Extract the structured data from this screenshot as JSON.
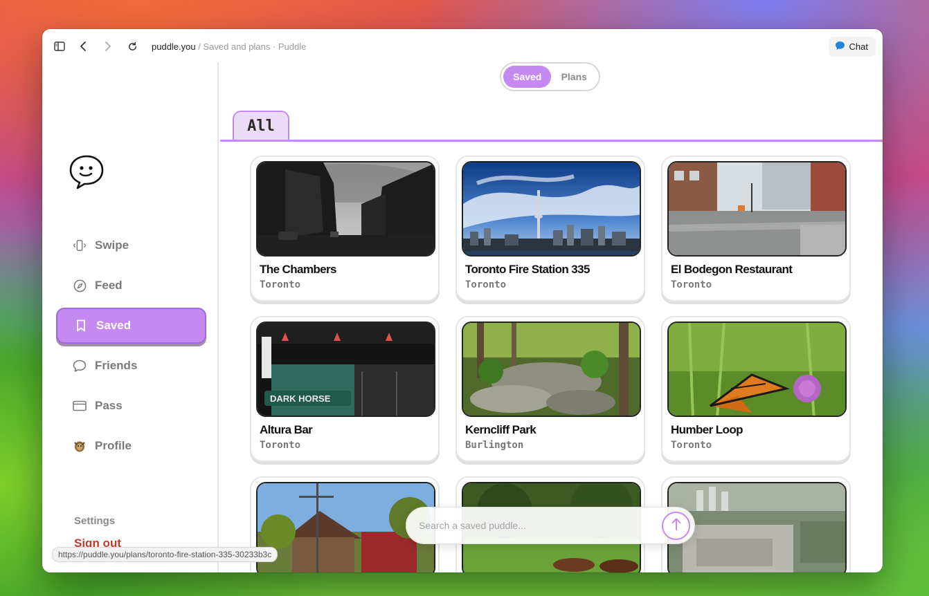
{
  "browser": {
    "url_domain": "puddle.you",
    "url_path": " / Saved and plans · Puddle",
    "chat_label": "Chat",
    "status_url": "https://puddle.you/plans/toronto-fire-station-335-30233b3c"
  },
  "sidebar": {
    "items": [
      {
        "label": "Swipe",
        "icon": "swipe-icon"
      },
      {
        "label": "Feed",
        "icon": "compass-icon"
      },
      {
        "label": "Saved",
        "icon": "bookmark-icon",
        "active": true
      },
      {
        "label": "Friends",
        "icon": "chat-bubble-icon"
      },
      {
        "label": "Pass",
        "icon": "card-icon"
      },
      {
        "label": "Profile",
        "icon": "avatar-icon"
      }
    ],
    "settings": "Settings",
    "sign_out": "Sign out"
  },
  "main": {
    "segment": {
      "saved": "Saved",
      "plans": "Plans",
      "selected": "Saved"
    },
    "tab": "All",
    "cards": [
      {
        "name": "The Chambers",
        "city": "Toronto",
        "scene": "dark-street"
      },
      {
        "name": "Toronto Fire Station 335",
        "city": "Toronto",
        "scene": "skyline"
      },
      {
        "name": "El Bodegon Restaurant",
        "city": "Toronto",
        "scene": "intersection"
      },
      {
        "name": "Altura Bar",
        "city": "Toronto",
        "scene": "bar-front"
      },
      {
        "name": "Kerncliff Park",
        "city": "Burlington",
        "scene": "forest"
      },
      {
        "name": "Humber Loop",
        "city": "Toronto",
        "scene": "butterfly"
      },
      {
        "name": "",
        "city": "",
        "scene": "houses"
      },
      {
        "name": "",
        "city": "",
        "scene": "park-cows"
      },
      {
        "name": "",
        "city": "",
        "scene": "aerial"
      }
    ],
    "search": {
      "placeholder": "Search a saved puddle..."
    }
  },
  "colors": {
    "accent": "#c58af0",
    "accent_border": "#a566d8",
    "sign_out": "#c0392b"
  }
}
